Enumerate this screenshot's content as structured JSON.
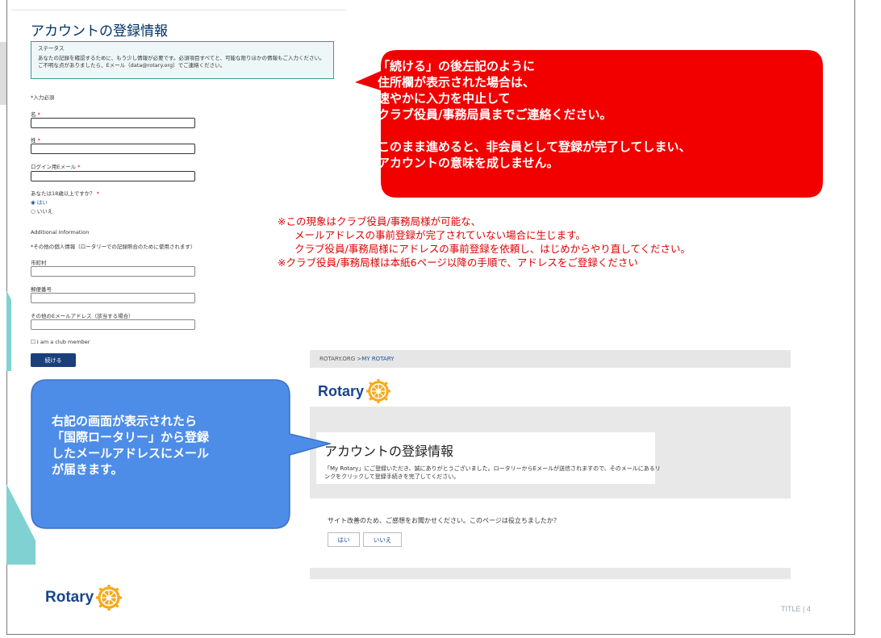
{
  "form": {
    "title": "アカウントの登録情報",
    "status_title": "ステータス",
    "status_text": "あなたの記録を確認するために、もう少し情報が必要です。必須項目すべてと、可能な限りほかの情報もご入力ください。ご不明な点がありましたら、Eメール（data@rotary.org）でご連絡ください。",
    "required_note": "*入力必須",
    "first_name_label": "名",
    "last_name_label": "姓",
    "login_email_label": "ログイン用Eメール",
    "required_mark": "*",
    "age_question": "あなたは18歳以上ですか？",
    "age_yes": "はい",
    "age_no": "いいえ",
    "additional_heading": "Additional Information",
    "additional_note": "*その他の個人情報（ロータリーでの記録照合のために使用されます）",
    "city_label": "市町村",
    "postal_label": "郵便番号",
    "other_email_label": "その他のEメールアドレス（該当する場合）",
    "club_member_label": "I am a club member",
    "continue_label": "続ける"
  },
  "red_callout": {
    "line1": "「続ける」の後左記のように",
    "line2": "住所欄が表示された場合は、",
    "line3": "速やかに入力を中止して",
    "line4": "クラブ役員/事務局員までご連絡ください。",
    "line5": "このまま進めると、非会員として登録が完了してしまい、",
    "line6": "アカウントの意味を成しません。"
  },
  "notes": {
    "line1": "※この現象はクラブ役員/事務局様が可能な、",
    "line2": "メールアドレスの事前登録が完了されていない場合に生じます。",
    "line3": "クラブ役員/事務局様にアドレスの事前登録を依頼し、はじめからやり直してください。",
    "line4": "※クラブ役員/事務局様は本紙6ページ以降の手順で、アドレスをご登録ください"
  },
  "confirmation": {
    "breadcrumb_root": "ROTARY.ORG > ",
    "breadcrumb_current": "MY ROTARY",
    "logo_text": "Rotary",
    "title": "アカウントの登録情報",
    "body": "「My Rotary」にご登録いただき、誠にありがとうございました。ロータリーからEメールが送信されますので、そのメールにあるリンクをクリックして登録手続きを完了してください。",
    "feedback_question": "サイト改善のため、ご感想をお聞かせください。このページは役立ちましたか？",
    "yes_label": "はい",
    "no_label": "いいえ"
  },
  "blue_callout": {
    "line1": "右記の画面が表示されたら",
    "line2": "「国際ロータリー」から登録",
    "line3": "したメールアドレスにメール",
    "line4": "が届きます。"
  },
  "footer": {
    "logo_text": "Rotary",
    "page_label": "TITLE | 4"
  },
  "colors": {
    "rotary_blue": "#17458f",
    "rotary_gold": "#f7a81b",
    "callout_red": "#f20000",
    "callout_blue": "#4d8de8",
    "teal": "#7fd1d2",
    "button_navy": "#1b3f7a"
  }
}
